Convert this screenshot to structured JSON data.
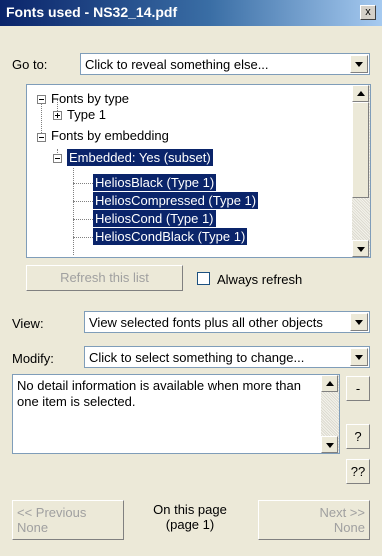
{
  "window": {
    "title": "Fonts used - NS32_14.pdf",
    "close_label": "x"
  },
  "goto": {
    "label": "Go to:",
    "value": "Click to reveal something else..."
  },
  "tree": {
    "nodes": [
      {
        "label": "Fonts by type",
        "expander": "−"
      },
      {
        "label": "Type 1",
        "expander": "+"
      },
      {
        "label": "Fonts by embedding",
        "expander": "−"
      },
      {
        "label": "Embedded: Yes (subset)",
        "expander": "−",
        "selected": true
      },
      {
        "label": "HeliosBlack (Type 1)",
        "selected": true
      },
      {
        "label": "HeliosCompressed (Type 1)",
        "selected": true
      },
      {
        "label": "HeliosCond (Type 1)",
        "selected": true
      },
      {
        "label": "HeliosCondBlack (Type 1)",
        "selected": true
      }
    ]
  },
  "refresh": {
    "label": "Refresh this list",
    "always_label": "Always refresh",
    "always_checked": false
  },
  "view": {
    "label": "View:",
    "value": "View selected fonts plus all other objects"
  },
  "modify": {
    "label": "Modify:",
    "value": "Click to select something to change..."
  },
  "detail": {
    "text": "No detail information is available when more than one item is selected.",
    "side_buttons": [
      "-",
      "?",
      "??"
    ]
  },
  "nav": {
    "previous_line1": "<< Previous",
    "previous_line2": "None",
    "center_line1": "On this page",
    "center_line2": "(page 1)",
    "next_line1": "Next >>",
    "next_line2": "None"
  },
  "colors": {
    "selection": "#0a246a",
    "face": "#ece9d8",
    "border": "#7f9db9"
  }
}
